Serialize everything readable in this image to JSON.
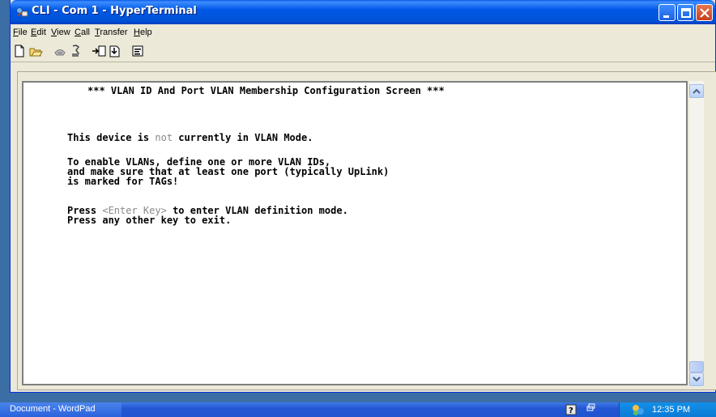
{
  "window": {
    "title": "CLI - Com 1 - HyperTerminal"
  },
  "menu": {
    "items": [
      "File",
      "Edit",
      "View",
      "Call",
      "Transfer",
      "Help"
    ]
  },
  "toolbar": {
    "buttons": [
      "new-icon",
      "open-icon",
      "connect-icon",
      "disconnect-icon",
      "send-icon",
      "receive-icon",
      "properties-icon"
    ]
  },
  "terminal": {
    "heading": "*** VLAN ID And Port VLAN Membership Configuration Screen ***",
    "line1_pre": "This device is ",
    "line1_dim": "not",
    "line1_post": " currently in VLAN Mode.",
    "line2": "To enable VLANs, define one or more VLAN IDs,",
    "line3": "and make sure that at least one port (typically UpLink)",
    "line4": "is marked for TAGs!",
    "line5_pre": "Press ",
    "line5_dim": "<Enter Key>",
    "line5_post": " to enter VLAN definition mode.",
    "line6": "Press any other key to exit."
  },
  "taskbar": {
    "task_label": "Document - WordPad",
    "clock": "12:35 PM"
  },
  "colors": {
    "titlebar": "#0058e6",
    "taskbar": "#2457d4",
    "tray": "#0d7ad6",
    "desktop": "#3a6ea5"
  }
}
